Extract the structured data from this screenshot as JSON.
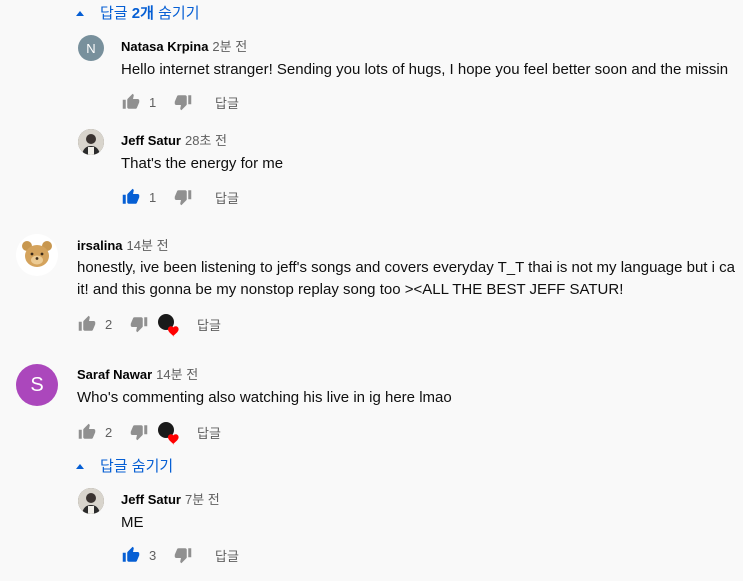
{
  "thread1": {
    "toggle_label_prefix": "답글 ",
    "toggle_label_bold": "2개",
    "toggle_label_suffix": " 숨기기",
    "replies": [
      {
        "avatar_letter": "N",
        "author": "Natasa Krpina",
        "time": "2분 전",
        "text": "Hello internet stranger! Sending you lots of hugs, I hope you feel better soon and the missin",
        "likes": "1",
        "liked": false,
        "reply_label": "답글"
      },
      {
        "author": "Jeff Satur",
        "time": "28초 전",
        "text": "That's the energy for me",
        "likes": "1",
        "liked": true,
        "reply_label": "답글"
      }
    ]
  },
  "comment_irsalina": {
    "author": "irsalina",
    "time": "14분 전",
    "text_line1": "honestly, ive been listening to jeff's songs and covers everyday T_T thai is not my language but i ca",
    "text_line2": "it! and this gonna be my nonstop replay song too ><ALL THE BEST JEFF SATUR!",
    "likes": "2",
    "reply_label": "답글"
  },
  "comment_saraf": {
    "avatar_letter": "S",
    "author": "Saraf Nawar",
    "time": "14분 전",
    "text": "Who's commenting also watching his live in ig here lmao",
    "likes": "2",
    "reply_label": "답글"
  },
  "thread2": {
    "toggle_label": "답글 숨기기",
    "reply": {
      "author": "Jeff Satur",
      "time": "7분 전",
      "text": "ME",
      "likes": "3",
      "liked": true,
      "reply_label": "답글"
    }
  },
  "colors": {
    "accent": "#065fd4",
    "avatar_n": "#78909c",
    "avatar_s": "#ab47bc",
    "heart": "#ff0000"
  }
}
